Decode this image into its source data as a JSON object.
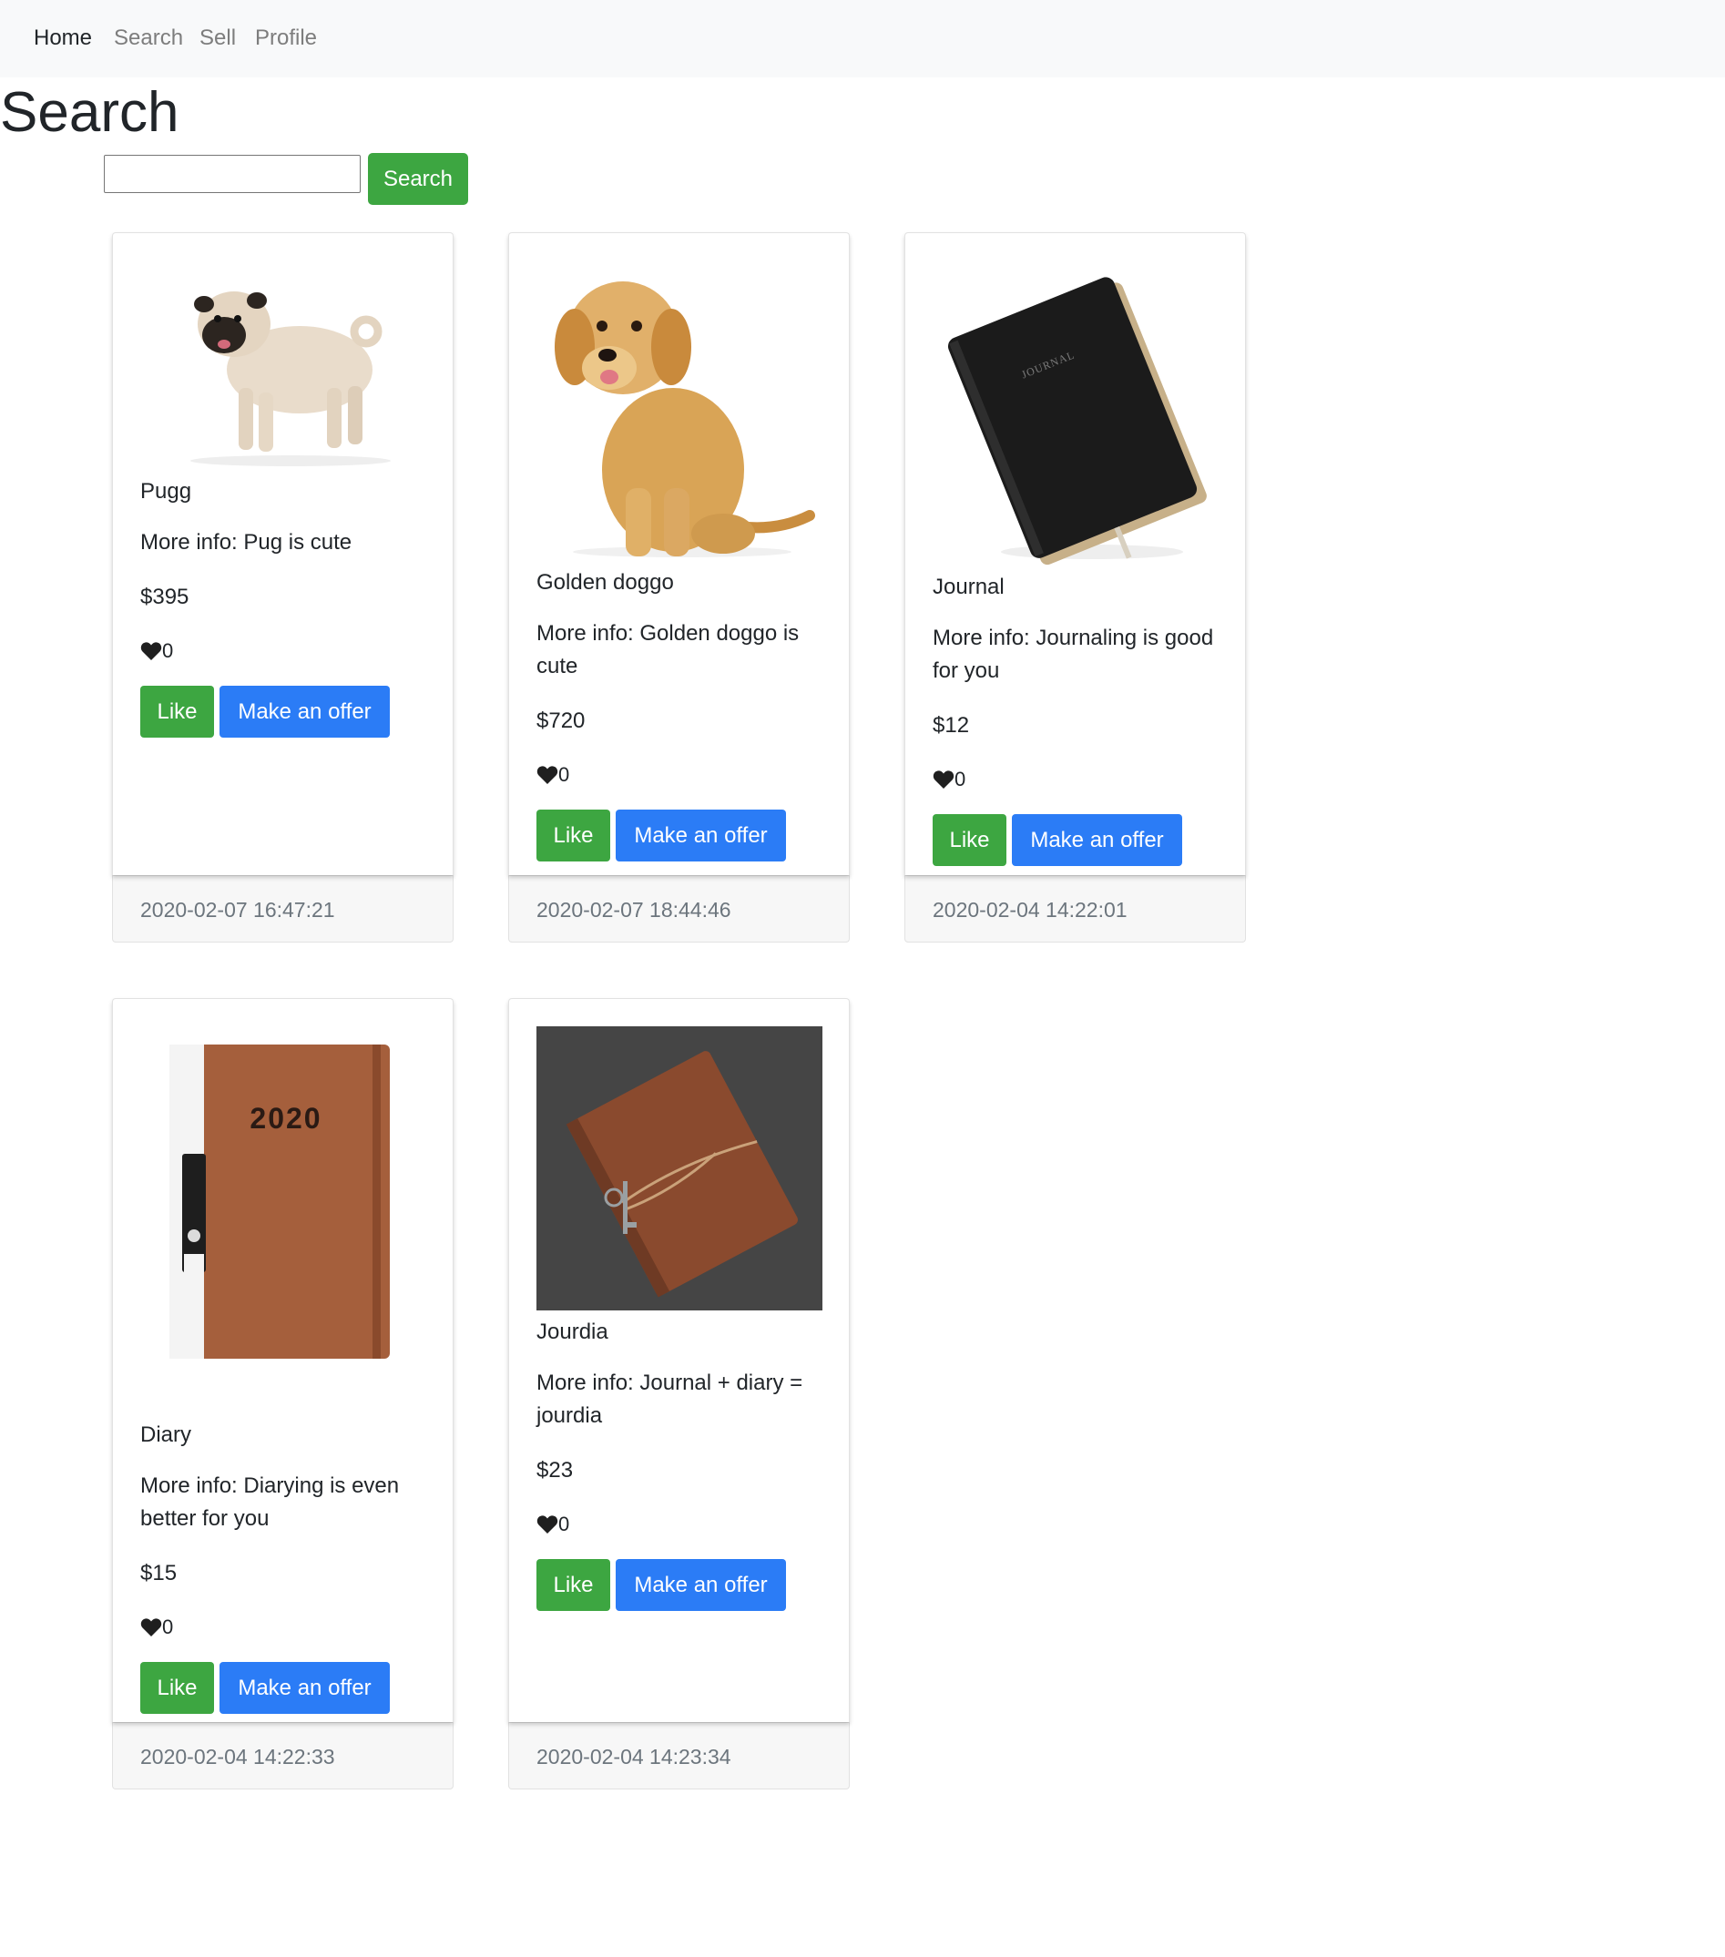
{
  "nav": {
    "items": [
      {
        "label": "Home",
        "active": true
      },
      {
        "label": "Search",
        "active": false
      },
      {
        "label": "Sell",
        "active": false
      },
      {
        "label": "Profile",
        "active": false
      }
    ]
  },
  "page": {
    "title": "Search"
  },
  "search": {
    "value": "",
    "placeholder": "",
    "button_label": "Search"
  },
  "colors": {
    "like": "#3da641",
    "offer": "#2b7cf6",
    "navbar_bg": "#f8f9fa"
  },
  "listings": [
    {
      "name": "Pugg",
      "info": "More info: Pug is cute",
      "price": "$395",
      "likes": "0",
      "like_label": "Like",
      "offer_label": "Make an offer",
      "timestamp": "2020-02-07 16:47:21",
      "image": "pug-dog-photo"
    },
    {
      "name": "Golden doggo",
      "info": "More info: Golden doggo is cute",
      "price": "$720",
      "likes": "0",
      "like_label": "Like",
      "offer_label": "Make an offer",
      "timestamp": "2020-02-07 18:44:46",
      "image": "golden-retriever-puppy-photo"
    },
    {
      "name": "Journal",
      "info": "More info: Journaling is good for you",
      "price": "$12",
      "likes": "0",
      "like_label": "Like",
      "offer_label": "Make an offer",
      "timestamp": "2020-02-04 14:22:01",
      "image": "black-journal-photo",
      "image_text": "JOURNAL"
    },
    {
      "name": "Diary",
      "info": "More info: Diarying is even better for you",
      "price": "$15",
      "likes": "0",
      "like_label": "Like",
      "offer_label": "Make an offer",
      "timestamp": "2020-02-04 14:22:33",
      "image": "brown-2020-diary-photo",
      "image_text": "2020"
    },
    {
      "name": "Jourdia",
      "info": "More info: Journal + diary = jourdia",
      "price": "$23",
      "likes": "0",
      "like_label": "Like",
      "offer_label": "Make an offer",
      "timestamp": "2020-02-04 14:23:34",
      "image": "leather-journal-with-key-photo"
    }
  ]
}
